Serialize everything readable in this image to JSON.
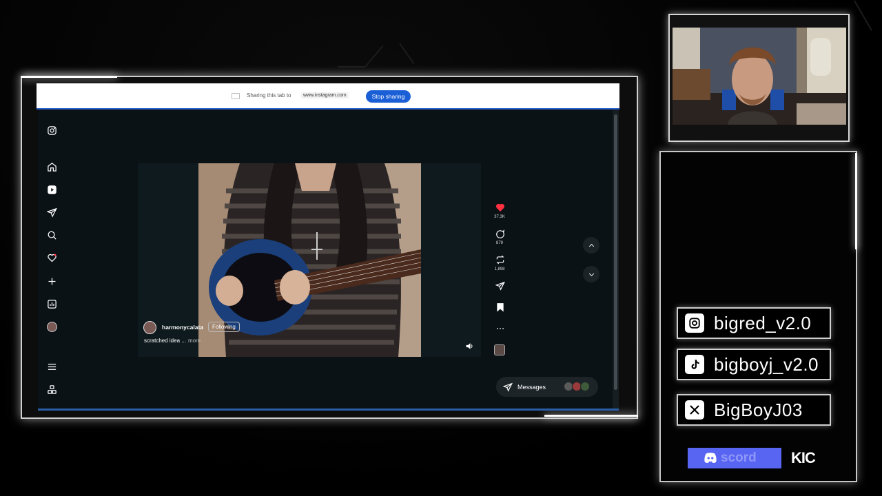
{
  "browser": {
    "share_text": "Sharing this tab to",
    "share_url": "www.instagram.com",
    "stop_sharing_label": "Stop sharing"
  },
  "instagram": {
    "nav_icons": [
      "instagram-icon",
      "home-icon",
      "reels-icon",
      "messages-icon",
      "search-icon",
      "notifications-icon",
      "create-icon",
      "dashboard-icon",
      "profile-icon",
      "more-icon",
      "threads-icon"
    ],
    "reel": {
      "username": "harmonycalata",
      "follow_label": "Following",
      "caption": "scratched idea ...",
      "caption_more": "more"
    },
    "actions": {
      "likes": "37.3K",
      "comments": "879",
      "reposts": "1,898"
    },
    "messages_label": "Messages",
    "accent_like": "#ff3040"
  },
  "overlay": {
    "socials": [
      {
        "platform": "instagram-icon",
        "handle": "bigred_v2.0"
      },
      {
        "platform": "tiktok-icon",
        "handle": "bigboyj_v2.0"
      },
      {
        "platform": "x-icon",
        "handle": "BigBoyJ03"
      }
    ],
    "discord_label": "scord",
    "kick_label": "KIC",
    "discord_color": "#5865f2"
  }
}
